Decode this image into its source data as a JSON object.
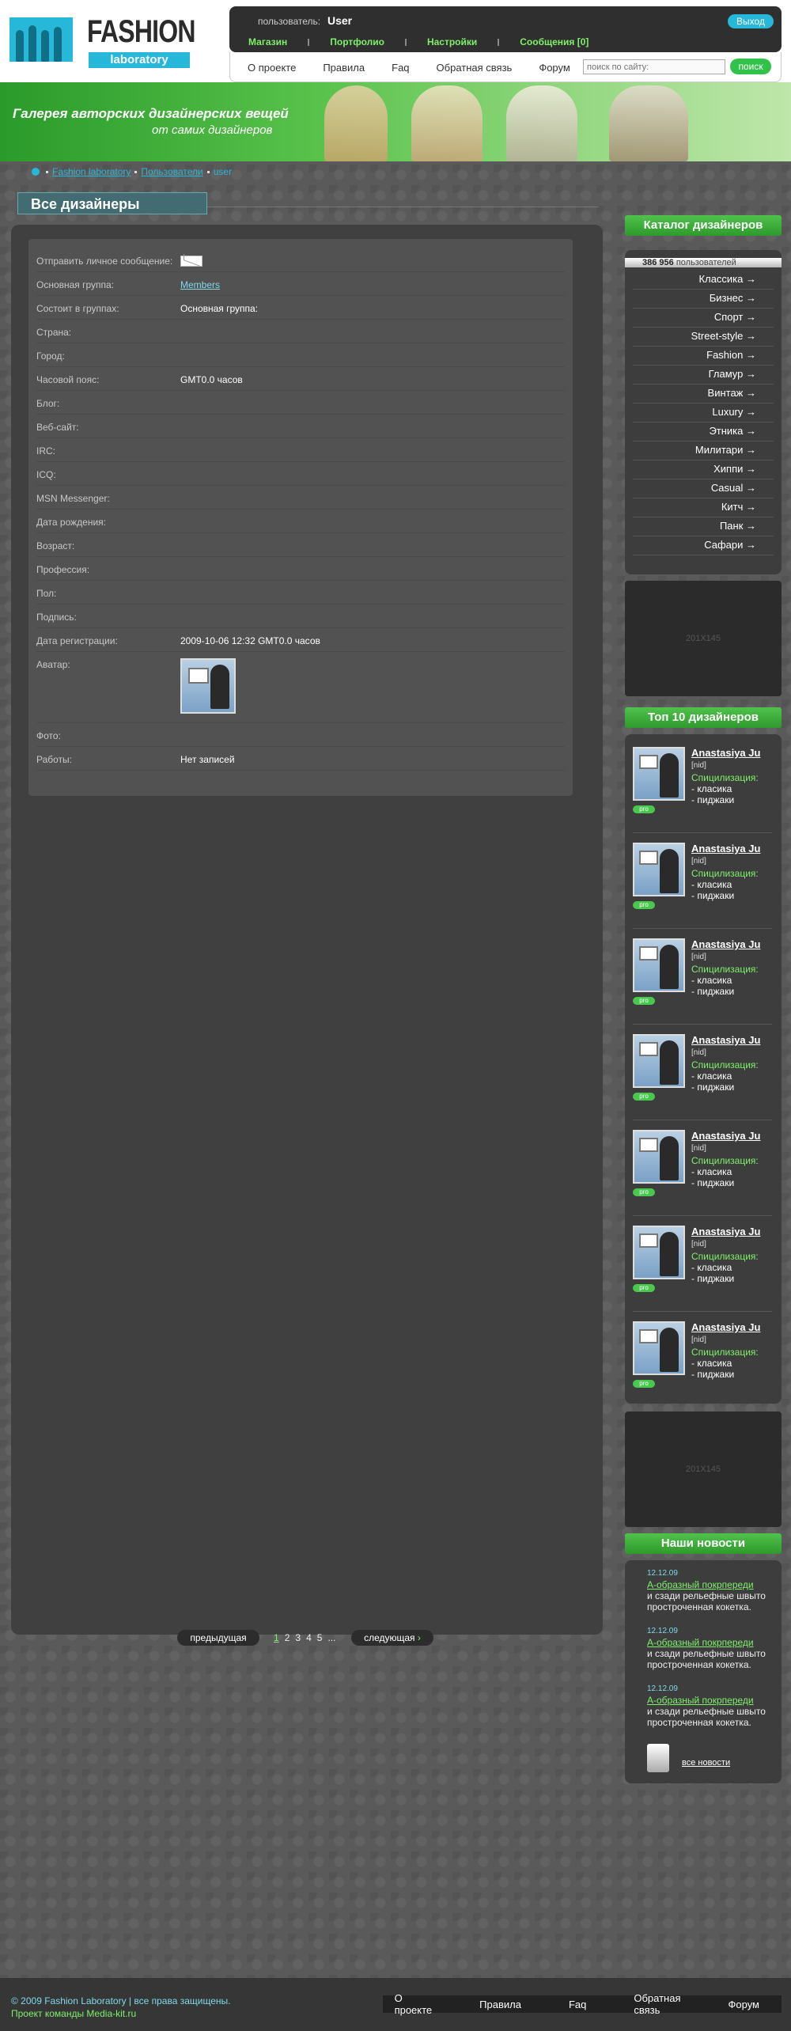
{
  "header": {
    "logo": {
      "word1": "FASHION",
      "word2": "laboratory"
    },
    "user_label": "пользователь:",
    "user_name": "User",
    "logout": "Выход",
    "user_menu": [
      "Магазин",
      "Портфолио",
      "Настройки",
      "Сообщения [0]"
    ],
    "nav": [
      "О проекте",
      "Правила",
      "Faq",
      "Обратная связь",
      "Форум"
    ],
    "search_placeholder": "поиск по сайту:",
    "search_button": "поиск"
  },
  "banner": {
    "line1": "Галерея авторских дизайнерских вещей",
    "line2": "от самих дизайнеров"
  },
  "breadcrumb": [
    "Fashion laboratory",
    "Пользователи",
    "user"
  ],
  "page_title": "Все дизайнеры",
  "profile": [
    {
      "label": "Отправить личное сообщение:",
      "value": ""
    },
    {
      "label": "Основная группа:",
      "value": "Members"
    },
    {
      "label": "Состоит в группах:",
      "value": "Основная группа:"
    },
    {
      "label": "Страна:",
      "value": ""
    },
    {
      "label": "Город:",
      "value": ""
    },
    {
      "label": "Часовой пояс:",
      "value": "GMT0.0 часов"
    },
    {
      "label": "Блог:",
      "value": ""
    },
    {
      "label": "Веб-сайт:",
      "value": ""
    },
    {
      "label": "IRC:",
      "value": ""
    },
    {
      "label": "ICQ:",
      "value": ""
    },
    {
      "label": "MSN Messenger:",
      "value": ""
    },
    {
      "label": "Дата рождения:",
      "value": ""
    },
    {
      "label": "Возраст:",
      "value": ""
    },
    {
      "label": "Профессия:",
      "value": ""
    },
    {
      "label": "Пол:",
      "value": ""
    },
    {
      "label": "Подпись:",
      "value": ""
    },
    {
      "label": "Дата регистрации:",
      "value": "2009-10-06 12:32 GMT0.0 часов"
    },
    {
      "label": "Аватар:",
      "value": ""
    },
    {
      "label": "Фото:",
      "value": ""
    },
    {
      "label": "Работы:",
      "value": "Нет записей"
    }
  ],
  "pager": {
    "prev": "предыдущая",
    "next": "следующая",
    "pages": [
      "1",
      "2",
      "3",
      "4",
      "5",
      "..."
    ]
  },
  "sidebar": {
    "catalog_title": "Каталог дизайнеров",
    "users_count": "386 956",
    "users_label": "пользователей",
    "catalog": [
      "Классика →",
      "Бизнес →",
      "Спорт →",
      "Street-style →",
      "Fashion →",
      "Гламур →",
      "Винтаж →",
      "Luxury →",
      "Этника →",
      "Милитари →",
      "Хиппи →",
      "Casual →",
      "Китч →",
      "Панк →",
      "Сафари →"
    ],
    "ad1": "201X145",
    "ad2": "201X145",
    "top_title": "Топ 10 дизайнеров",
    "designer": {
      "name": "Anastasiya Ju",
      "nick": "[nid]",
      "spec_label": "Спицилизация:",
      "spec1": "- класика",
      "spec2": "- пиджаки",
      "badge": "pro"
    },
    "news_title": "Наши новости",
    "news": [
      {
        "date": "12.12.09",
        "headline": "А-образный покрпереди",
        "text": "и сзади рельефные швыто простроченная кокетка."
      },
      {
        "date": "12.12.09",
        "headline": "А-образный покрпереди",
        "text": "и сзади рельефные швыто простроченная кокетка."
      },
      {
        "date": "12.12.09",
        "headline": "А-образный покрпереди",
        "text": "и сзади рельефные швыто простроченная кокетка."
      }
    ],
    "all_news": "все новости"
  },
  "footer": {
    "copyright": "© 2009 Fashion Laboratory | все права защищены.",
    "credit": "Проект команды Media-kit.ru",
    "nav": [
      "О проекте",
      "Правила",
      "Faq",
      "Обратная связь",
      "Форум"
    ]
  }
}
